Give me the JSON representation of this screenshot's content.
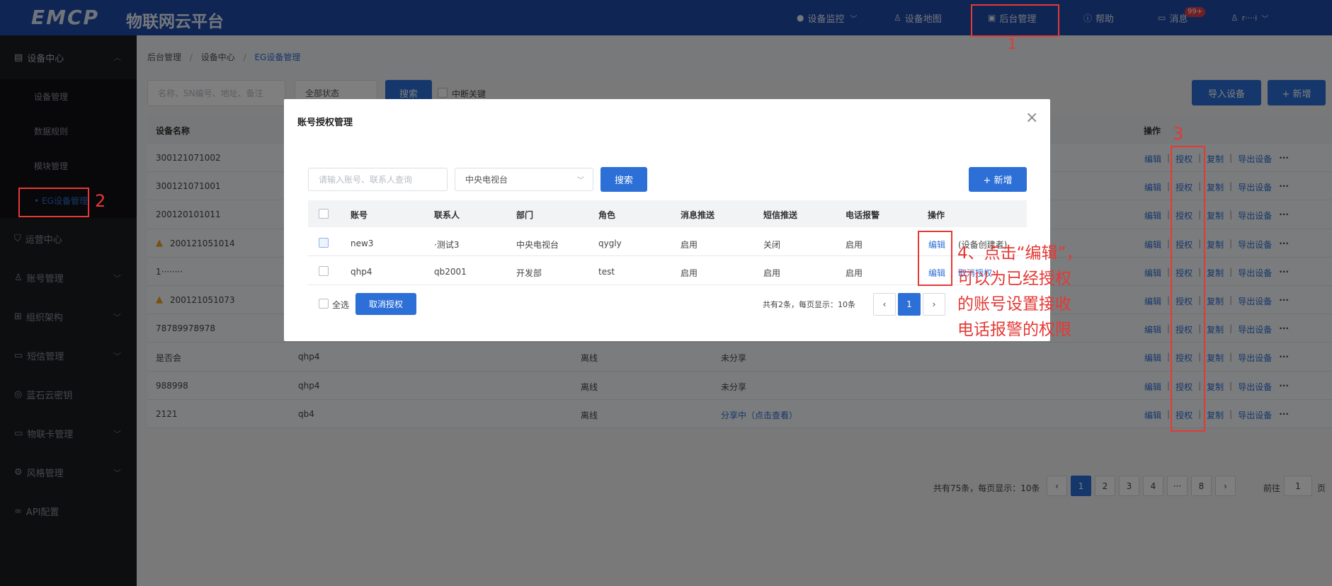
{
  "topbar": {
    "logo": "EMCP",
    "platform": "物联网云平台",
    "nav": [
      {
        "icon": "location-icon",
        "label": "设备监控"
      },
      {
        "icon": "user-icon",
        "label": "设备地图"
      },
      {
        "icon": "shield-icon",
        "label": "后台管理"
      },
      {
        "icon": "help-icon",
        "label": "帮助"
      },
      {
        "icon": "message-icon",
        "label": "消息"
      }
    ],
    "badge": "99+",
    "user_name": "r····i"
  },
  "sidebar": {
    "device_center": "设备中心",
    "sub": [
      "设备管理",
      "数据规则",
      "模块管理",
      "EG设备管理"
    ],
    "items": [
      "运营中心",
      "账号管理",
      "组织架构",
      "短信管理",
      "蓝石云密钥",
      "物联卡管理",
      "风格管理",
      "API配置"
    ]
  },
  "breadcrumb": [
    "后台管理",
    "设备中心",
    "EG设备管理"
  ],
  "toolbar": {
    "search_placeholder": "名称、SN编号、地址、备注",
    "status_select": "全部状态",
    "search_btn": "搜索",
    "include_sub": "中断关键",
    "import_btn": "导入设备",
    "add_btn": "+ 新增"
  },
  "table": {
    "col_name": "设备名称",
    "col_ops": "操作",
    "rows": [
      {
        "name": "300121071002",
        "owner": "",
        "status": "",
        "share": "",
        "warn": false
      },
      {
        "name": "300121071001",
        "owner": "",
        "status": "",
        "share": "",
        "warn": false
      },
      {
        "name": "200120101011",
        "owner": "",
        "status": "",
        "share": "",
        "warn": false
      },
      {
        "name": "200121051014",
        "owner": "",
        "status": "",
        "share": "",
        "warn": true
      },
      {
        "name": "1········",
        "owner": "",
        "status": "",
        "share": "",
        "warn": false
      },
      {
        "name": "200121051073",
        "owner": "",
        "status": "",
        "share": "",
        "warn": true
      },
      {
        "name": "78789978978",
        "owner": "",
        "status": "",
        "share": "",
        "warn": false
      },
      {
        "name": "是否会",
        "owner": "qhp4",
        "status": "离线",
        "share": "未分享",
        "warn": false
      },
      {
        "name": "988998",
        "owner": "qhp4",
        "status": "离线",
        "share": "未分享",
        "warn": false
      },
      {
        "name": "2121",
        "owner": "qb4",
        "status": "离线",
        "share": "分享中（点击查看）",
        "warn": false
      }
    ],
    "ops": [
      "编辑",
      "授权",
      "复制",
      "导出设备",
      "···"
    ]
  },
  "pager": {
    "summary": "共有75条，每页显示：10条",
    "pages": [
      "1",
      "2",
      "3",
      "4",
      "···",
      "8"
    ],
    "prev": "‹",
    "next": "›",
    "goto_label": "前往",
    "goto_value": "1",
    "page_suffix": "页"
  },
  "modal": {
    "title": "账号授权管理",
    "close": "×",
    "search_placeholder": "请输入账号、联系人查询",
    "dept_select": "中央电视台",
    "search_btn": "搜索",
    "add_btn": "+ 新增",
    "headers": [
      "账号",
      "联系人",
      "部门",
      "角色",
      "消息推送",
      "短信推送",
      "电话报警",
      "操作"
    ],
    "rows": [
      {
        "account": "new3",
        "contact": "·测试3",
        "dept": "中央电视台",
        "role": "qygly",
        "msg": "启用",
        "sms": "关闭",
        "phone": "启用",
        "op": "编辑",
        "note": "(设备创建者)"
      },
      {
        "account": "qhp4",
        "contact": "qb2001",
        "dept": "开发部",
        "role": "test",
        "msg": "启用",
        "sms": "启用",
        "phone": "启用",
        "op": "编辑",
        "note": "取消授权"
      }
    ],
    "select_all": "全选",
    "cancel_auth_btn": "取消授权",
    "summary": "共有2条，每页显示：10条",
    "prev": "‹",
    "page": "1",
    "next": "›"
  },
  "annotations": {
    "n1": "1",
    "n2": "2",
    "n3": "3",
    "note_lines": [
      "4、点击“编辑”，",
      "可以为已经授权",
      "的账号设置接收",
      "电话报警的权限"
    ],
    "accent": "#e53935"
  }
}
